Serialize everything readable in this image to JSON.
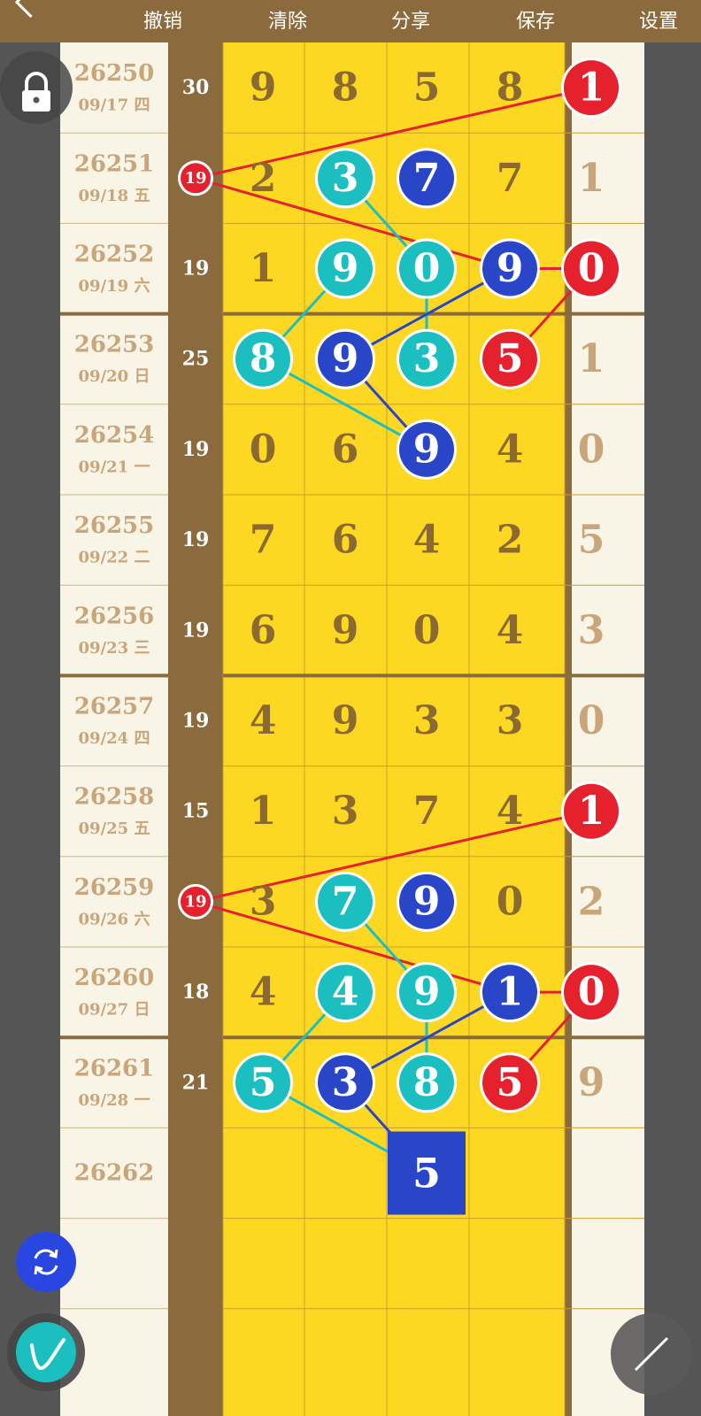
{
  "toolbar": {
    "undo": "撤销",
    "clear": "清除",
    "share": "分享",
    "save": "保存",
    "settings": "设置"
  },
  "colors": {
    "yellow": "#fdd823",
    "brown": "#8b6a3e",
    "cream": "#f8f4e6",
    "red": "#e5212e",
    "teal": "#1cbfbf",
    "blue": "#2a46c8",
    "digit": "#8a6a30",
    "faded": "#c8a57a"
  },
  "rows": [
    {
      "issue": "26250",
      "date": "09/17 四",
      "sum": "30",
      "sum_mark": false,
      "d": [
        "9",
        "8",
        "5",
        "8"
      ],
      "m": [
        null,
        null,
        null,
        null
      ],
      "last": "1",
      "last_mark": true
    },
    {
      "issue": "26251",
      "date": "09/18 五",
      "sum": "19",
      "sum_mark": true,
      "d": [
        "2",
        "3",
        "7",
        "7"
      ],
      "m": [
        null,
        "teal",
        "blue",
        null
      ],
      "last": "1",
      "last_mark": false
    },
    {
      "issue": "26252",
      "date": "09/19 六",
      "sum": "19",
      "sum_mark": false,
      "d": [
        "1",
        "9",
        "0",
        "9"
      ],
      "m": [
        null,
        "teal",
        "teal",
        "blue"
      ],
      "last": "0",
      "last_mark": true
    },
    {
      "issue": "26253",
      "date": "09/20 日",
      "sum": "25",
      "sum_mark": false,
      "d": [
        "8",
        "9",
        "3",
        "5"
      ],
      "m": [
        "teal",
        "blue",
        "teal",
        "red"
      ],
      "last": "1",
      "last_mark": false
    },
    {
      "issue": "26254",
      "date": "09/21 一",
      "sum": "19",
      "sum_mark": false,
      "d": [
        "0",
        "6",
        "9",
        "4"
      ],
      "m": [
        null,
        null,
        "blue",
        null
      ],
      "last": "0",
      "last_mark": false
    },
    {
      "issue": "26255",
      "date": "09/22 二",
      "sum": "19",
      "sum_mark": false,
      "d": [
        "7",
        "6",
        "4",
        "2"
      ],
      "m": [
        null,
        null,
        null,
        null
      ],
      "last": "5",
      "last_mark": false
    },
    {
      "issue": "26256",
      "date": "09/23 三",
      "sum": "19",
      "sum_mark": false,
      "d": [
        "6",
        "9",
        "0",
        "4"
      ],
      "m": [
        null,
        null,
        null,
        null
      ],
      "last": "3",
      "last_mark": false
    },
    {
      "issue": "26257",
      "date": "09/24 四",
      "sum": "19",
      "sum_mark": false,
      "d": [
        "4",
        "9",
        "3",
        "3"
      ],
      "m": [
        null,
        null,
        null,
        null
      ],
      "last": "0",
      "last_mark": false
    },
    {
      "issue": "26258",
      "date": "09/25 五",
      "sum": "15",
      "sum_mark": false,
      "d": [
        "1",
        "3",
        "7",
        "4"
      ],
      "m": [
        null,
        null,
        null,
        null
      ],
      "last": "1",
      "last_mark": true
    },
    {
      "issue": "26259",
      "date": "09/26 六",
      "sum": "19",
      "sum_mark": true,
      "d": [
        "3",
        "7",
        "9",
        "0"
      ],
      "m": [
        null,
        "teal",
        "blue",
        null
      ],
      "last": "2",
      "last_mark": false
    },
    {
      "issue": "26260",
      "date": "09/27 日",
      "sum": "18",
      "sum_mark": false,
      "d": [
        "4",
        "4",
        "9",
        "1"
      ],
      "m": [
        null,
        "teal",
        "teal",
        "blue"
      ],
      "last": "0",
      "last_mark": true
    },
    {
      "issue": "26261",
      "date": "09/28 一",
      "sum": "21",
      "sum_mark": false,
      "d": [
        "5",
        "3",
        "8",
        "5"
      ],
      "m": [
        "teal",
        "blue",
        "teal",
        "red"
      ],
      "last": "9",
      "last_mark": false
    },
    {
      "issue": "26262",
      "date": "",
      "sum": "",
      "sum_mark": false,
      "d": [
        "",
        "",
        "5",
        ""
      ],
      "m": [
        null,
        null,
        "bluesq",
        null
      ],
      "last": "",
      "last_mark": false
    },
    {
      "issue": "",
      "date": "",
      "sum": "",
      "sum_mark": false,
      "d": [
        "",
        "",
        "",
        ""
      ],
      "m": [
        null,
        null,
        null,
        null
      ],
      "last": "",
      "last_mark": false
    },
    {
      "issue": "",
      "date": "",
      "sum": "",
      "sum_mark": false,
      "d": [
        "",
        "",
        "",
        ""
      ],
      "m": [
        null,
        null,
        null,
        null
      ],
      "last": "",
      "last_mark": false
    }
  ],
  "links": [
    {
      "color": "red",
      "a": [
        0,
        "last"
      ],
      "b": [
        1,
        "sum"
      ]
    },
    {
      "color": "red",
      "a": [
        1,
        "sum"
      ],
      "b": [
        2,
        "d3"
      ]
    },
    {
      "color": "red",
      "a": [
        2,
        "d3"
      ],
      "b": [
        2,
        "last"
      ]
    },
    {
      "color": "red",
      "a": [
        2,
        "last"
      ],
      "b": [
        3,
        "d3"
      ]
    },
    {
      "color": "teal",
      "a": [
        1,
        "d1"
      ],
      "b": [
        2,
        "d2"
      ]
    },
    {
      "color": "teal",
      "a": [
        2,
        "d2"
      ],
      "b": [
        3,
        "d2"
      ]
    },
    {
      "color": "teal",
      "a": [
        2,
        "d1"
      ],
      "b": [
        3,
        "d0"
      ]
    },
    {
      "color": "teal",
      "a": [
        3,
        "d0"
      ],
      "b": [
        4,
        "d2"
      ]
    },
    {
      "color": "blue",
      "a": [
        2,
        "d3"
      ],
      "b": [
        3,
        "d1"
      ]
    },
    {
      "color": "blue",
      "a": [
        3,
        "d1"
      ],
      "b": [
        4,
        "d2"
      ]
    },
    {
      "color": "red",
      "a": [
        8,
        "last"
      ],
      "b": [
        9,
        "sum"
      ]
    },
    {
      "color": "red",
      "a": [
        9,
        "sum"
      ],
      "b": [
        10,
        "d3"
      ]
    },
    {
      "color": "red",
      "a": [
        10,
        "d3"
      ],
      "b": [
        10,
        "last"
      ]
    },
    {
      "color": "red",
      "a": [
        10,
        "last"
      ],
      "b": [
        11,
        "d3"
      ]
    },
    {
      "color": "teal",
      "a": [
        9,
        "d1"
      ],
      "b": [
        10,
        "d2"
      ]
    },
    {
      "color": "teal",
      "a": [
        10,
        "d2"
      ],
      "b": [
        11,
        "d2"
      ]
    },
    {
      "color": "teal",
      "a": [
        10,
        "d1"
      ],
      "b": [
        11,
        "d0"
      ]
    },
    {
      "color": "teal",
      "a": [
        11,
        "d0"
      ],
      "b": [
        12,
        "d2"
      ]
    },
    {
      "color": "blue",
      "a": [
        10,
        "d3"
      ],
      "b": [
        11,
        "d1"
      ]
    },
    {
      "color": "blue",
      "a": [
        11,
        "d1"
      ],
      "b": [
        12,
        "d2"
      ]
    }
  ],
  "icons": {
    "back": "chevron-left-icon",
    "lock": "lock-icon",
    "refresh": "refresh-icon",
    "pen": "pen-icon",
    "line": "line-tool-icon"
  }
}
